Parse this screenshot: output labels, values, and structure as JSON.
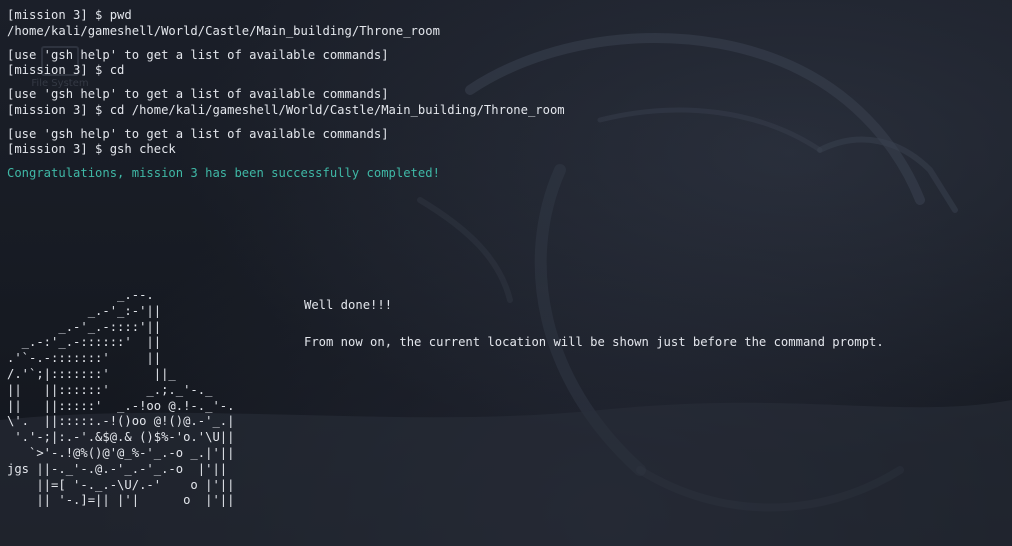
{
  "terminal": {
    "lines": [
      "[mission 3] $ pwd",
      "/home/kali/gameshell/World/Castle/Main_building/Throne_room",
      "",
      "[use 'gsh help' to get a list of available commands]",
      "[mission 3] $ cd",
      "",
      "[use 'gsh help' to get a list of available commands]",
      "[mission 3] $ cd /home/kali/gameshell/World/Castle/Main_building/Throne_room",
      "",
      "[use 'gsh help' to get a list of available commands]",
      "[mission 3] $ gsh check",
      "",
      "Congratulations, mission 3 has been successfully completed!"
    ],
    "success_color": "#3fb8a6"
  },
  "desktop": {
    "icon_label": "File System",
    "icon_name": "folder-icon"
  },
  "art": {
    "lines": [
      "               _.--.",
      "           _.-'_:-'||",
      "       _.-'_.-::::'||",
      "  _.-:'_.-::::::'  ||",
      ".'`-.-:::::::'     ||",
      "/.'`;|:::::::'      ||_",
      "||   ||::::::'     _.;._'-._",
      "||   ||:::::'  _.-!oo @.!-._'-.",
      "\\'.  ||:::::.-!()oo @!()@.-'_.|",
      " '.'-;|:.-'.&$@.& ()$%-'o.'\\U||",
      "   `>'-.!@%()@'@_%-'_.-o _.|'||",
      "jgs ||-._'-.@.-'_.-'_.-o  |'||",
      "    ||=[ '-._.-\\U/.-'    o |'||",
      "    || '-.]=|| |'|      o  |'||"
    ]
  },
  "message": {
    "line1": "Well done!!!",
    "line2": "From now on, the current location will be shown just before the command prompt."
  }
}
